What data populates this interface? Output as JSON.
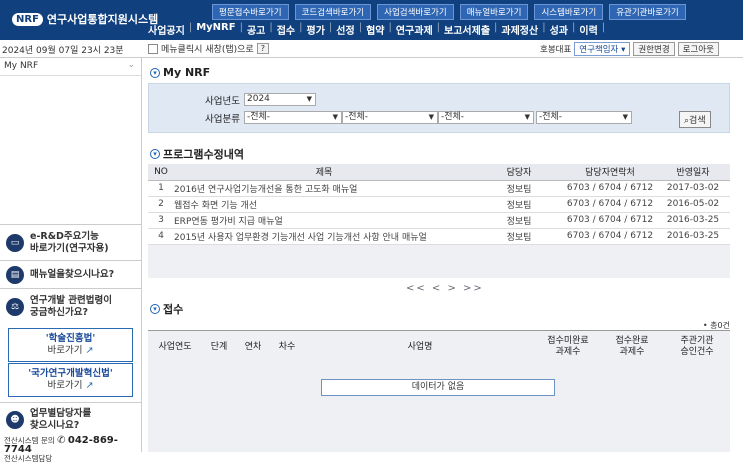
{
  "header": {
    "logo_badge": "NRF",
    "logo_text": "연구사업통합지원시스템",
    "quick_links": [
      "평문접수바로가기",
      "코드검색바로가기",
      "사업검색바로가기",
      "매뉴얼바로가기",
      "시스템바로가기",
      "유관기관바로가기"
    ],
    "nav": [
      "사업공지",
      "MyNRF",
      "공고",
      "접수",
      "평가",
      "선정",
      "협약",
      "연구과제",
      "보고서제출",
      "과제정산",
      "성과",
      "이력"
    ]
  },
  "subbar": {
    "datetime": "2024년 09월 07일 23시 23분",
    "tab_option": "메뉴클릭시 새창(탭)으로",
    "help": "?",
    "user_prefix": "호봉대표",
    "role": "연구책임자",
    "role_btn": "권한변경",
    "logout": "로그아웃"
  },
  "sidebar": {
    "menu": "My NRF",
    "items": [
      {
        "text": "e-R&D주요기능\n바로가기(연구자용)",
        "icon": "monitor-icon"
      },
      {
        "text": "매뉴얼을찾으시나요?",
        "icon": "manual-icon"
      },
      {
        "text": "연구개발 관련법령이\n궁금하신가요?",
        "icon": "scale-icon"
      },
      {
        "text": "업무별담당자를\n찾으시나요?",
        "icon": "person-icon"
      }
    ],
    "law_buttons": [
      {
        "title": "'학술진흥법'",
        "sub": "바로가기"
      },
      {
        "title": "'국가연구개발혁신법'",
        "sub": "바로가기"
      }
    ],
    "contact_label": "전산시스템 문의",
    "contact_sub": "전산시스템담당",
    "phone": "042-869-7744"
  },
  "mynrf": {
    "title": "My NRF",
    "year_label": "사업년도",
    "year": "2024",
    "class_label": "사업분류",
    "class_selects": [
      "-전체-",
      "-전체-",
      "-전체-",
      "-전체-"
    ],
    "search_btn": "검색"
  },
  "program": {
    "title": "프로그램수정내역",
    "headers": [
      "NO",
      "제목",
      "담당자",
      "담당자연락처",
      "반영일자"
    ],
    "rows": [
      [
        "1",
        "2016년 연구사업기능개선을 통한 고도화 매뉴얼",
        "정보팀",
        "6703 / 6704 / 6712",
        "2017-03-02"
      ],
      [
        "2",
        "웹접수 화면 기능 개선",
        "정보팀",
        "6703 / 6704 / 6712",
        "2016-05-02"
      ],
      [
        "3",
        "ERP연동 평가비 지급 매뉴얼",
        "정보팀",
        "6703 / 6704 / 6712",
        "2016-03-25"
      ],
      [
        "4",
        "2015년 사용자 업무환경 기능개선 사업 기능개선 사항 안내 매뉴얼",
        "정보팀",
        "6703 / 6704 / 6712",
        "2016-03-25"
      ]
    ],
    "pager": "<< < > >>"
  },
  "receipt": {
    "title": "접수",
    "total": "• 총0건",
    "headers": [
      "사업연도",
      "단계",
      "연차",
      "차수",
      "사업명",
      "접수미완료\n과제수",
      "접수완료\n과제수",
      "주관기관\n승인건수"
    ],
    "empty": "데이터가 없음"
  }
}
